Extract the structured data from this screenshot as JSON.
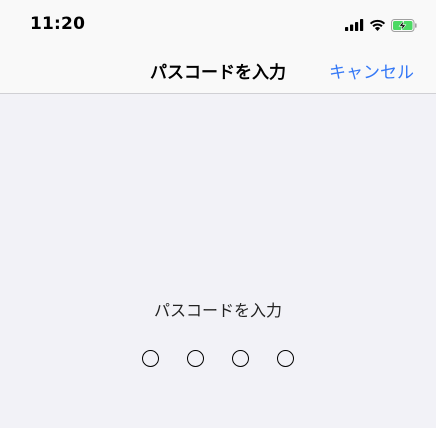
{
  "status_bar": {
    "time": "11:20",
    "icons": [
      "cellular-signal-icon",
      "wifi-icon",
      "battery-charging-icon"
    ]
  },
  "nav": {
    "title": "パスコードを入力",
    "cancel_label": "キャンセル"
  },
  "main": {
    "prompt": "パスコードを入力",
    "passcode_length": 4,
    "entered_digits": 0
  },
  "colors": {
    "accent": "#3478f6",
    "battery_charge": "#4cd964",
    "background": "#f2f2f7",
    "bar_background": "#f9f9f9"
  }
}
